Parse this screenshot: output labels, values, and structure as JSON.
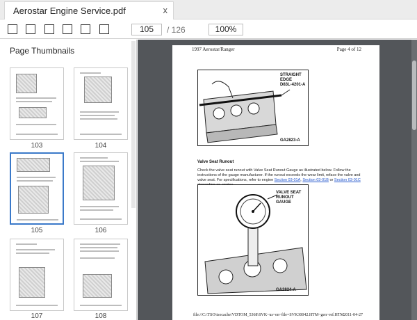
{
  "tab": {
    "title": "Aerostar Engine Service.pdf",
    "close": "x"
  },
  "toolbar": {
    "current_page": "105",
    "page_total": "/ 126",
    "zoom": "100%"
  },
  "sidebar": {
    "title": "Page Thumbnails",
    "thumbnails": [
      {
        "page": "103"
      },
      {
        "page": "104"
      },
      {
        "page": "105",
        "selected": true
      },
      {
        "page": "106"
      },
      {
        "page": "107"
      },
      {
        "page": "108"
      }
    ]
  },
  "document": {
    "header_left": "1997 Aerostar/Ranger",
    "header_right": "Page 4 of 12",
    "figure1": {
      "label_line1": "STRAIGHT",
      "label_line2": "EDGE",
      "label_line3": "D83L-4201-A",
      "id": "GA2823-A"
    },
    "section_title": "Valve Seat Runout",
    "paragraph_start": "Check the valve seat runout with Valve Seat Runout Gauge as illustrated below. Follow the instructions of the gauge manufacturer. If the runout exceeds the wear limit, reface the valve and valve seat. For specifications, refer to engine ",
    "link1": "Section 03-01A",
    "sep1": ", ",
    "link2": "Section 03-01B",
    "sep2": " or ",
    "link3": "Section 03-01C",
    "paragraph_end": " depending on engine.",
    "figure2": {
      "label_line1": "VALVE SEAT",
      "label_line2": "RUNOUT GAUGE",
      "id": "GA2824-A"
    },
    "footer_left": "file://C:\\TSO\\tsocache\\VDTOM_5368\\SVK~us~en~file=SVK30042.HTM~gen~ref.HTM",
    "footer_right": "2011-04-27"
  }
}
